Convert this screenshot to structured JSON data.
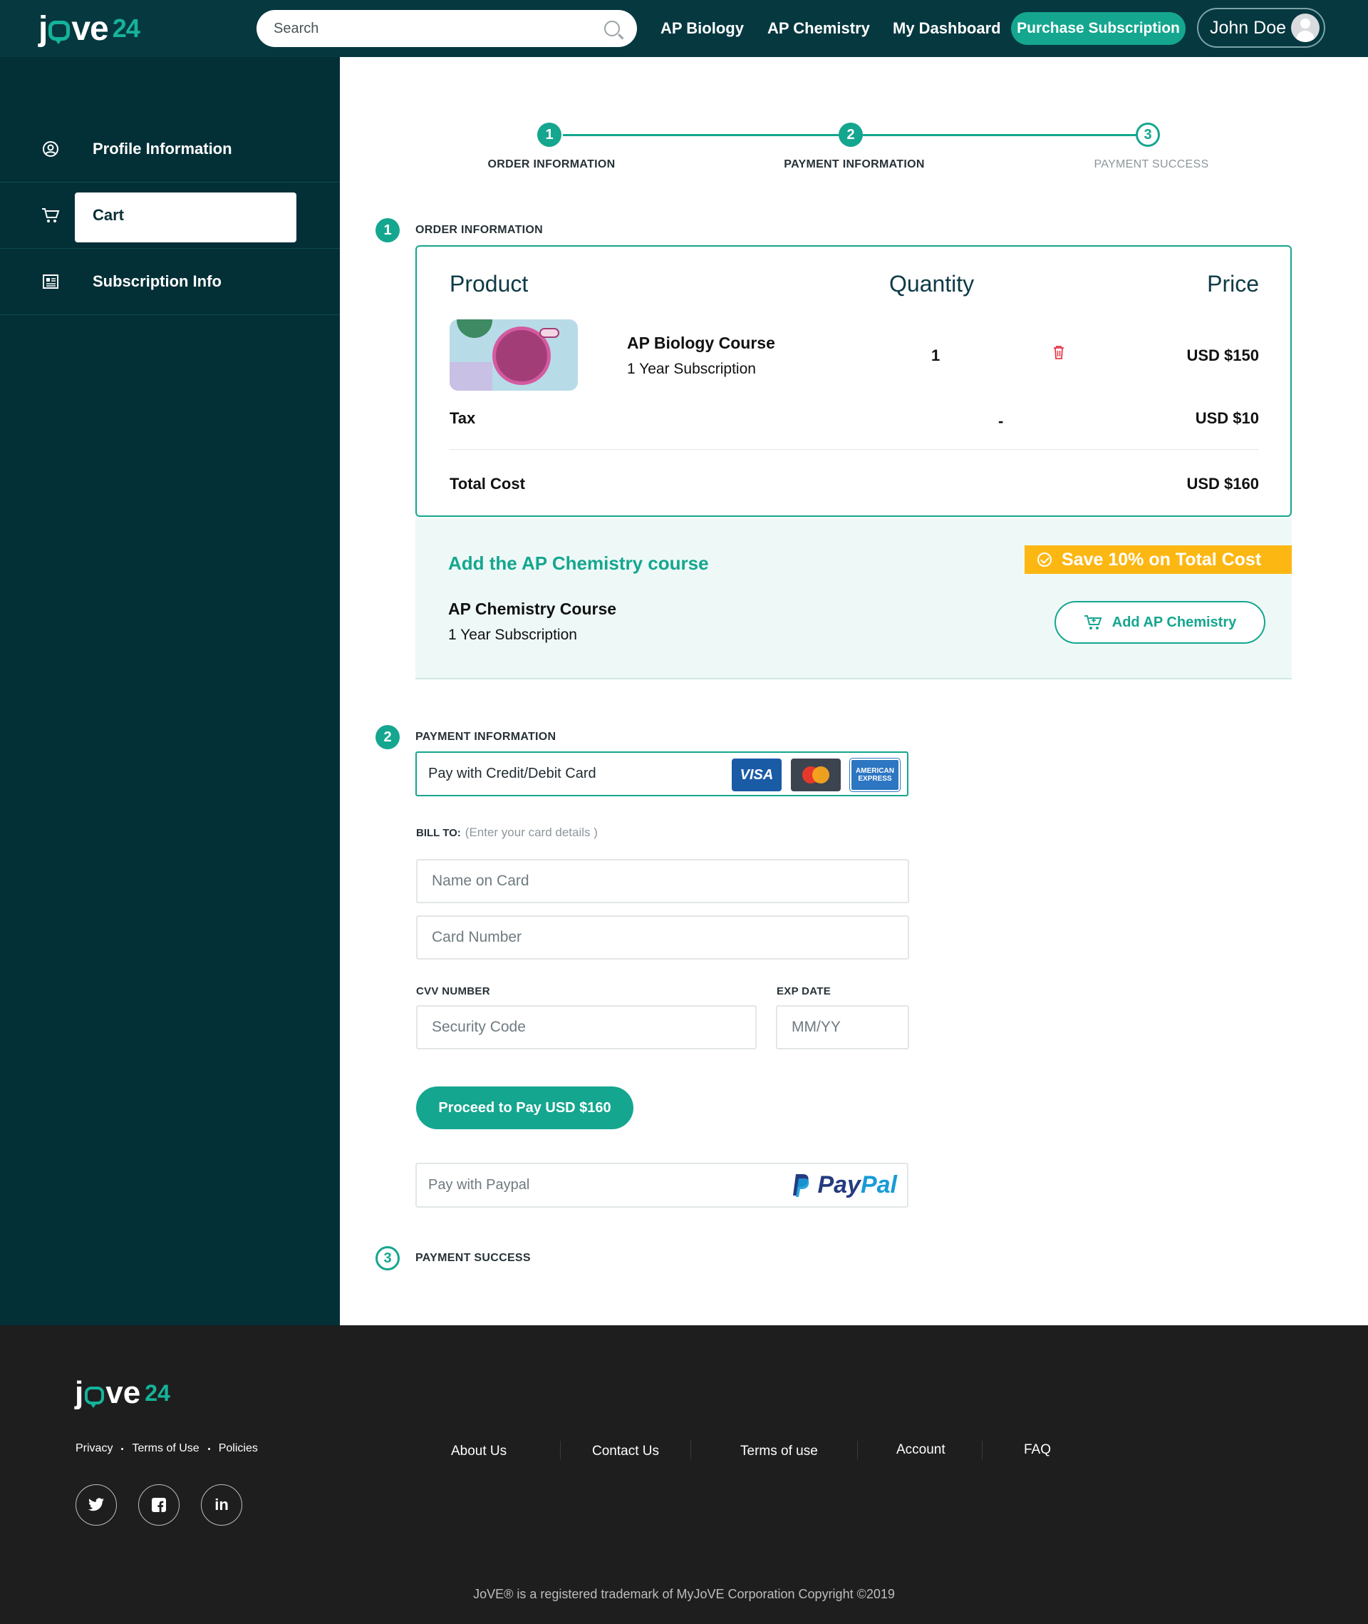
{
  "header": {
    "logo_text": "jove",
    "logo_num": "24",
    "search_placeholder": "Search",
    "nav": [
      "AP Biology",
      "AP Chemistry",
      "My Dashboard"
    ],
    "purchase_label": "Purchase Subscription",
    "user_name": "John Doe"
  },
  "sidebar": {
    "items": [
      {
        "label": "Profile Information",
        "icon": "user-circle-icon"
      },
      {
        "label": "Cart",
        "icon": "cart-icon"
      },
      {
        "label": "Subscription Info",
        "icon": "news-icon"
      }
    ],
    "active": "Cart"
  },
  "stepper": {
    "steps": [
      {
        "num": "1",
        "label": "ORDER INFORMATION"
      },
      {
        "num": "2",
        "label": "PAYMENT INFORMATION"
      },
      {
        "num": "3",
        "label": "PAYMENT SUCCESS"
      }
    ]
  },
  "order": {
    "section_num": "1",
    "section_title": "ORDER INFORMATION",
    "col_product": "Product",
    "col_quantity": "Quantity",
    "col_price": "Price",
    "item_name": "AP Biology Course",
    "item_sub": "1 Year Subscription",
    "item_qty": "1",
    "item_price": "USD $150",
    "tax_label": "Tax",
    "tax_qty": "-",
    "tax_price": "USD $10",
    "total_label": "Total Cost",
    "total_price": "USD $160"
  },
  "upsell": {
    "title": "Add the AP Chemistry course",
    "save_badge": "Save 10% on Total Cost",
    "course_name": "AP Chemistry Course",
    "course_sub": "1 Year Subscription",
    "add_button": "Add AP Chemistry"
  },
  "payment": {
    "section_num": "2",
    "section_title": "PAYMENT INFORMATION",
    "card_option": "Pay with Credit/Debit Card",
    "card_logos": {
      "visa": "VISA",
      "amex_line1": "AMERICAN",
      "amex_line2": "EXPRESS"
    },
    "bill_to": "BILL TO:",
    "bill_hint": "(Enter your card details )",
    "name_placeholder": "Name on Card",
    "number_placeholder": "Card Number",
    "cvv_label": "CVV NUMBER",
    "cvv_placeholder": "Security Code",
    "exp_label": "EXP DATE",
    "exp_placeholder": "MM/YY",
    "pay_button": "Proceed to Pay USD $160",
    "paypal_option": "Pay with Paypal",
    "paypal_logo_1": "Pay",
    "paypal_logo_2": "Pal"
  },
  "success": {
    "section_num": "3",
    "section_title": "PAYMENT SUCCESS"
  },
  "footer": {
    "logo_text": "jove",
    "logo_num": "24",
    "legal": [
      "Privacy",
      "Terms of Use",
      "Policies"
    ],
    "links": [
      "About Us",
      "Contact Us",
      "Terms of use",
      "Account",
      "FAQ"
    ],
    "social": [
      "twitter-icon",
      "facebook-icon",
      "linkedin-icon"
    ],
    "copyright": "JoVE® is a registered trademark of MyJoVE Corporation Copyright ©2019"
  },
  "colors": {
    "accent": "#15a68f",
    "header_bg": "#063840",
    "sidebar_bg": "#032f37",
    "save_badge": "#fdb713",
    "footer_bg": "#1e1e1e"
  }
}
